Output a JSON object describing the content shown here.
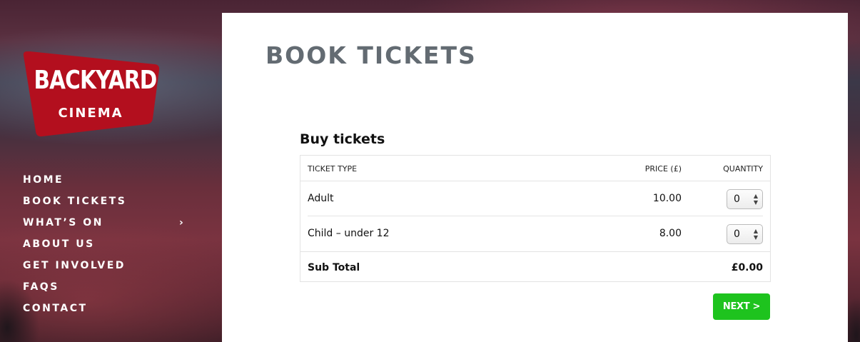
{
  "brand": {
    "logo_line1": "BACKYARD",
    "logo_line2": "CINEMA",
    "logo_color": "#b30f1e"
  },
  "nav": {
    "items": [
      {
        "label": "HOME"
      },
      {
        "label": "BOOK TICKETS"
      },
      {
        "label": "WHAT’S ON",
        "chevron": "›"
      },
      {
        "label": "ABOUT US"
      },
      {
        "label": "GET INVOLVED"
      },
      {
        "label": "FAQS"
      },
      {
        "label": "CONTACT"
      }
    ]
  },
  "main": {
    "page_title": "BOOK TICKETS",
    "section_title": "Buy tickets",
    "table": {
      "headers": {
        "type": "TICKET TYPE",
        "price": "PRICE (£)",
        "quantity": "QUANTITY"
      },
      "rows": [
        {
          "name": "Adult",
          "price": "10.00",
          "quantity": "0"
        },
        {
          "name": "Child – under 12",
          "price": "8.00",
          "quantity": "0"
        }
      ],
      "subtotal_label": "Sub Total",
      "subtotal_value": "£0.00"
    },
    "next_label": "NEXT >",
    "accent_color": "#1ec31e"
  }
}
